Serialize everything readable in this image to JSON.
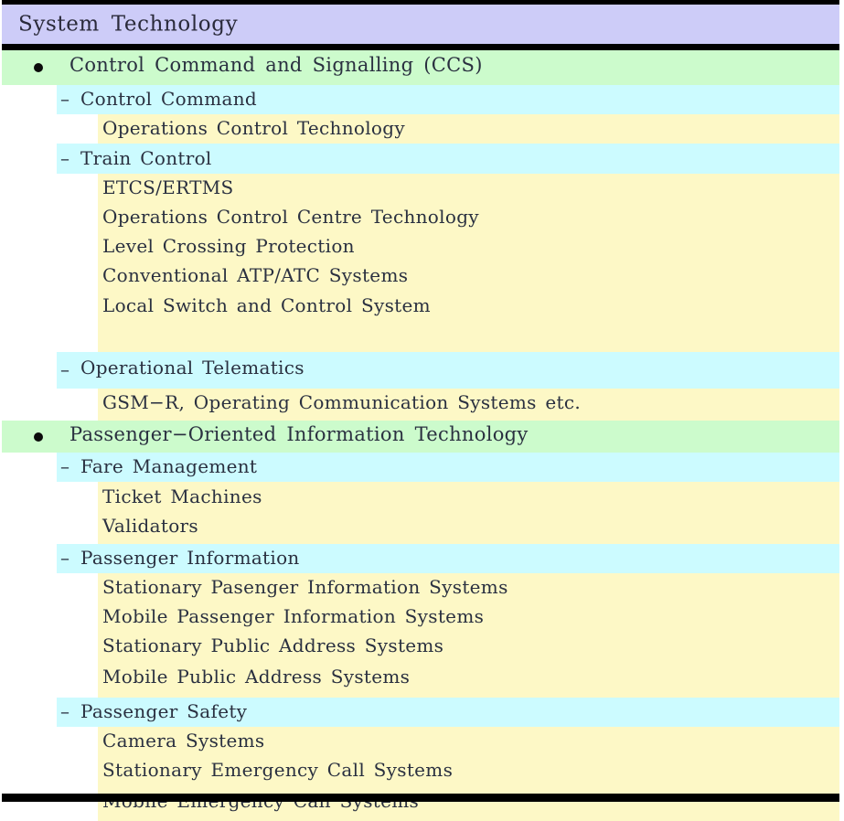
{
  "document": {
    "header": {
      "title": "System Technology"
    },
    "markers": {
      "level1": "•",
      "level2": "–"
    },
    "colors": {
      "header_band": "#cdccf8",
      "level1_band": "#ccfbcc",
      "level2_band": "#ccfbff",
      "level3_band": "#fdf8c6",
      "rule": "#000000",
      "text": "#2a3040"
    },
    "rows": [
      {
        "level": 1,
        "label": "Control Command and Signalling (CCS)",
        "height": 38
      },
      {
        "level": 2,
        "label": "Control Command",
        "height": 32
      },
      {
        "level": 3,
        "label": "Operations Control Technology",
        "height": 32
      },
      {
        "level": 2,
        "label": "Train Control",
        "height": 33
      },
      {
        "level": 3,
        "label": "ETCS/ERTMS",
        "height": 32
      },
      {
        "level": 3,
        "label": "Operations Control Centre Technology",
        "height": 32
      },
      {
        "level": 3,
        "label": "Level Crossing Protection",
        "height": 32
      },
      {
        "level": 3,
        "label": "Conventional ATP/ATC Systems",
        "height": 32
      },
      {
        "level": 3,
        "label": "Local Switch and Control System",
        "height": 37
      },
      {
        "level": 3,
        "label": "",
        "height": 30
      },
      {
        "level": 2,
        "label": "Operational Telematics",
        "height": 40
      },
      {
        "level": 3,
        "label": "GSM−R, Operating Communication Systems etc.",
        "height": 35
      },
      {
        "level": 1,
        "label": "Passenger−Oriented Information Technology",
        "height": 35
      },
      {
        "level": 2,
        "label": "Fare Management",
        "height": 32
      },
      {
        "level": 3,
        "label": "Ticket Machines",
        "height": 33
      },
      {
        "level": 3,
        "label": "Validators",
        "height": 35
      },
      {
        "level": 2,
        "label": "Passenger Information",
        "height": 32
      },
      {
        "level": 3,
        "label": "Stationary Pasenger Information Systems",
        "height": 32
      },
      {
        "level": 3,
        "label": "Mobile Passenger Information Systems",
        "height": 32
      },
      {
        "level": 3,
        "label": "Stationary Public Address Systems",
        "height": 32
      },
      {
        "level": 3,
        "label": "Mobile Public Address Systems",
        "height": 40
      },
      {
        "level": 2,
        "label": "Passenger Safety",
        "height": 32
      },
      {
        "level": 3,
        "label": "Camera Systems",
        "height": 32
      },
      {
        "level": 3,
        "label": "Stationary Emergency Call Systems",
        "height": 32
      },
      {
        "level": 3,
        "label": "Mobile Emergency Call Systems",
        "height": 39
      }
    ]
  }
}
